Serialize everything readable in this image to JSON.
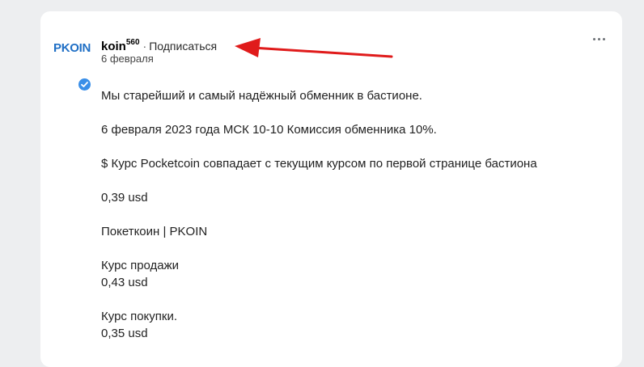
{
  "post": {
    "avatar_text": "PKOIN",
    "author": "koin",
    "author_superscript": "560",
    "separator": "·",
    "subscribe_label": "Подписаться",
    "date": "6 февраля",
    "menu_icon": "more-horizontal-icon",
    "paragraphs": [
      "Мы старейший и самый надёжный обменник в бастионе.",
      "6 февраля 2023 года МСК 10-10 Комиссия обменника 10%.",
      "$ Курс Pocketcoin совпадает с текущим курсом по первой странице бастиона",
      "0,39 usd",
      "Покеткоин | PKOIN"
    ],
    "sell": {
      "label": "Курс продажи",
      "value": "0,43 usd"
    },
    "buy": {
      "label": "Курс покупки.",
      "value": "0,35 usd"
    }
  },
  "colors": {
    "page_background": "#edeef0",
    "card_background": "#ffffff",
    "avatar_brand": "#1f6fc5",
    "verified_badge": "#3a8fe8",
    "annotation_arrow": "#e01b1b"
  }
}
